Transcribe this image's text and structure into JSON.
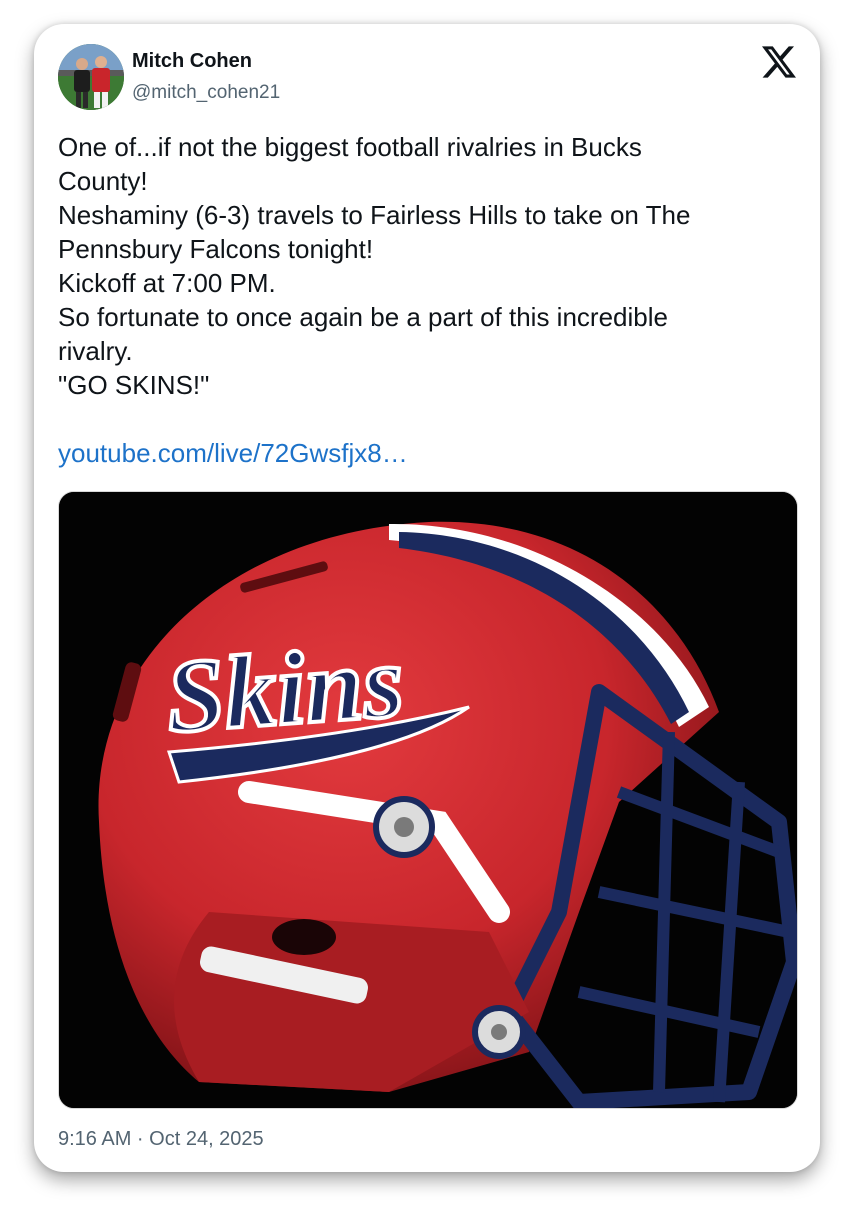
{
  "author": {
    "name": "Mitch Cohen",
    "handle": "@mitch_cohen21"
  },
  "post": {
    "lines": [
      "One of...if not the biggest football rivalries in Bucks",
      "County!",
      "Neshaminy (6-3) travels to Fairless Hills to take on The",
      "Pennsbury Falcons tonight!",
      "Kickoff at 7:00 PM.",
      "So fortunate to once again be a part of this incredible",
      "rivalry.",
      "\"GO SKINS!\""
    ],
    "link_text": "youtube.com/live/72Gwsfjx8…",
    "media_wordmark": "Skins",
    "timestamp": "9:16 AM · Oct 24, 2025"
  },
  "icons": {
    "platform": "x-logo-icon"
  },
  "colors": {
    "link": "#1d72c9",
    "helmet_red": "#c8262c",
    "helmet_navy": "#1b2a5e",
    "background": "#030303"
  }
}
